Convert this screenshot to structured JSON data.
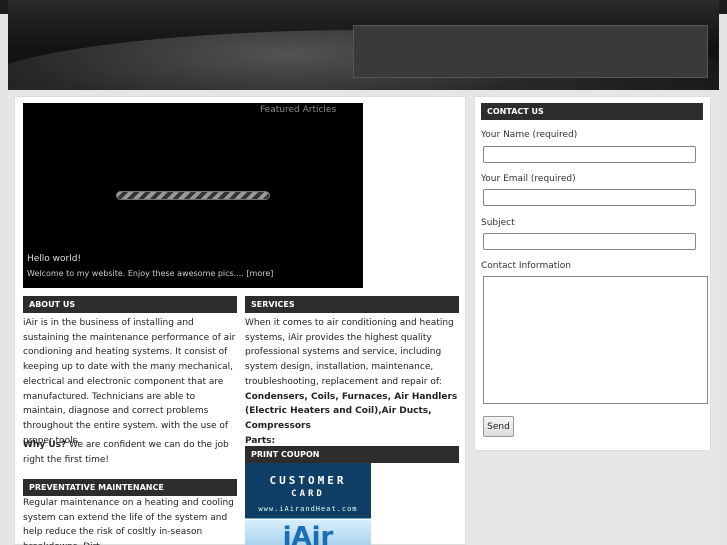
{
  "slider": {
    "featured_label": "Featured Articles",
    "caption_title": "Hello world!",
    "caption_text": "Welcome to my website. Enjoy these awesome pics.... ",
    "more_link": "[more]"
  },
  "about": {
    "heading": "ABOUT US",
    "body": "iAir is in the business of installing and sustaining the maintenance performance of air condioning and heating systems. It consist of keeping up to date with the many mechanical, electrical and electronic component that are manufactured. Technicians are able to maintain, diagnose and correct problems throughout the entire system. with the use of proper tools.",
    "why_label": "Why Us?",
    "why_text": " We are confident we can do the job right the first time!"
  },
  "maintenance": {
    "heading": "PREVENTATIVE MAINTENANCE",
    "body": "Regular maintenance on a heating and cooling system can extend the life of the system and help reduce the risk of cosltly in-season breakdowns. Dirt"
  },
  "services": {
    "heading": "SERVICES",
    "body": "When it comes to air conditioning and heating systems, iAir provides the highest quality professional systems and service, including system design, installation, maintenance, troubleshooting, replacement and repair of: ",
    "bold_list": "Condensers, Coils, Furnaces, Air Handlers (Electric Heaters and Coil),Air Ducts, Compressors",
    "parts_label": "Parts:"
  },
  "coupon": {
    "heading": "PRINT COUPON",
    "card_line1": "CUSTOMER",
    "card_line2": "CARD",
    "card_url": "www.iAirandHeat.com",
    "logo_text": "iAir"
  },
  "contact": {
    "heading": "CONTACT US",
    "name_label": "Your Name (required)",
    "email_label": "Your Email (required)",
    "subject_label": "Subject",
    "info_label": "Contact Information",
    "send_label": "Send"
  }
}
